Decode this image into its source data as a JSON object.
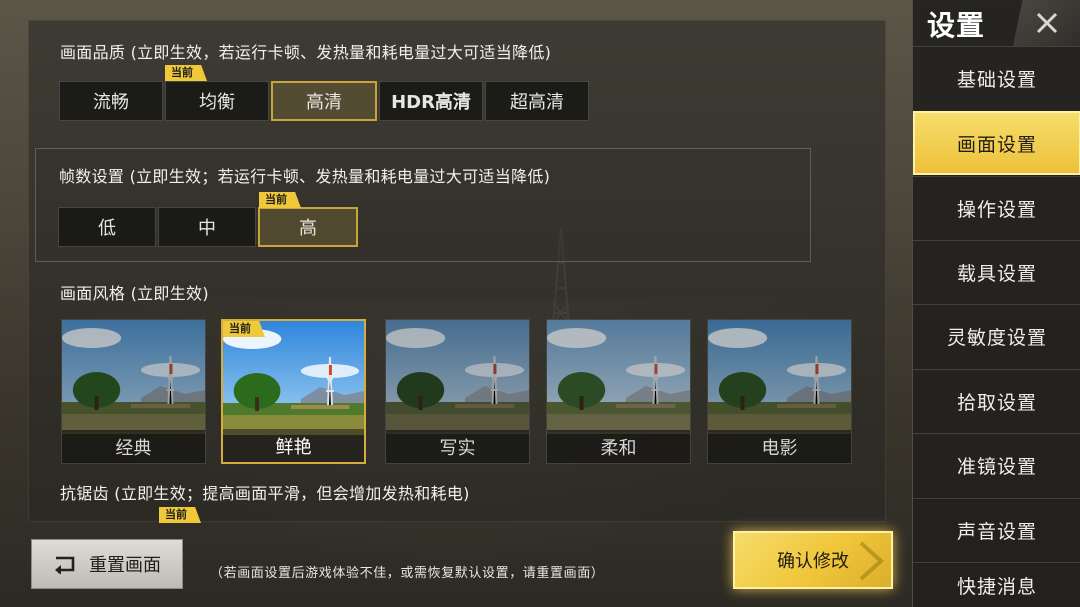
{
  "quality": {
    "title": "画面品质 (立即生效，若运行卡顿、发热量和耗电量过大可适当降低)",
    "options": [
      "流畅",
      "均衡",
      "高清",
      "HDR高清",
      "超高清"
    ],
    "current_badge": "当前"
  },
  "fps": {
    "title": "帧数设置 (立即生效；若运行卡顿、发热量和耗电量过大可适当降低)",
    "options": [
      "低",
      "中",
      "高"
    ],
    "current_badge": "当前"
  },
  "style": {
    "title": "画面风格 (立即生效)",
    "options": [
      "经典",
      "鲜艳",
      "写实",
      "柔和",
      "电影"
    ],
    "current_badge": "当前"
  },
  "antialias": {
    "title": "抗锯齿 (立即生效；提高画面平滑，但会增加发热和耗电)",
    "current_badge": "当前"
  },
  "bottom": {
    "reset_label": "重置画面",
    "hint": "（若画面设置后游戏体验不佳，或需恢复默认设置，请重置画面）",
    "confirm_label": "确认修改"
  },
  "sidebar": {
    "title": "设置",
    "items": [
      "基础设置",
      "画面设置",
      "操作设置",
      "载具设置",
      "灵敏度设置",
      "拾取设置",
      "准镜设置",
      "声音设置",
      "快捷消息"
    ]
  },
  "colors": {
    "accent_gold": "#f0c93a",
    "selected_border": "#c8a53b"
  },
  "icons": {
    "close": "close-x-icon",
    "reset": "reset-arrow-icon"
  }
}
